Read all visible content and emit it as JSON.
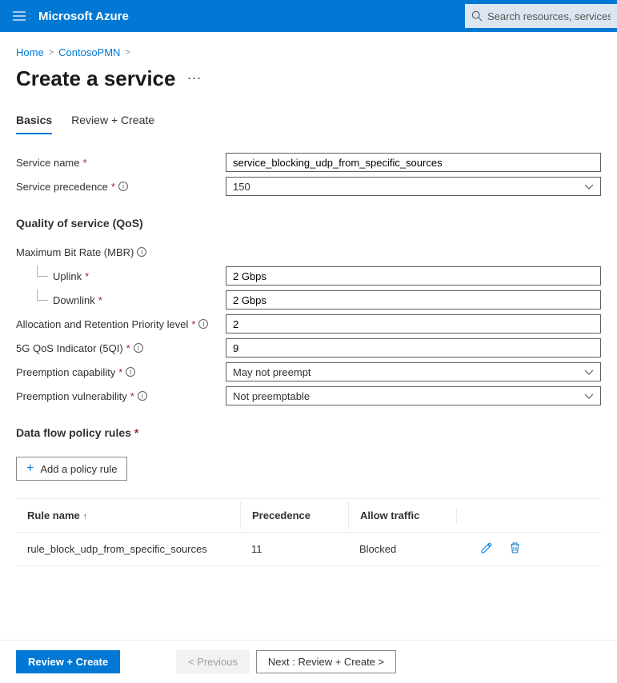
{
  "header": {
    "brand": "Microsoft Azure",
    "search_placeholder": "Search resources, services, and"
  },
  "breadcrumb": {
    "home": "Home",
    "parent": "ContosoPMN"
  },
  "page": {
    "title": "Create a service"
  },
  "tabs": {
    "basics": "Basics",
    "review": "Review + Create"
  },
  "labels": {
    "service_name": "Service name",
    "service_precedence": "Service precedence",
    "qos_heading": "Quality of service (QoS)",
    "mbr": "Maximum Bit Rate (MBR)",
    "uplink": "Uplink",
    "downlink": "Downlink",
    "arp": "Allocation and Retention Priority level",
    "fiveqi": "5G QoS Indicator (5QI)",
    "preempt_cap": "Preemption capability",
    "preempt_vul": "Preemption vulnerability",
    "dfpr_heading": "Data flow policy rules",
    "add_rule": "Add a policy rule"
  },
  "values": {
    "service_name": "service_blocking_udp_from_specific_sources",
    "service_precedence": "150",
    "uplink": "2 Gbps",
    "downlink": "2 Gbps",
    "arp": "2",
    "fiveqi": "9",
    "preempt_cap": "May not preempt",
    "preempt_vul": "Not preemptable"
  },
  "table": {
    "headers": {
      "rule_name": "Rule name",
      "precedence": "Precedence",
      "allow": "Allow traffic"
    },
    "rows": [
      {
        "name": "rule_block_udp_from_specific_sources",
        "precedence": "11",
        "allow": "Blocked"
      }
    ]
  },
  "footer": {
    "review_create": "Review + Create",
    "previous": "< Previous",
    "next": "Next : Review + Create >"
  }
}
